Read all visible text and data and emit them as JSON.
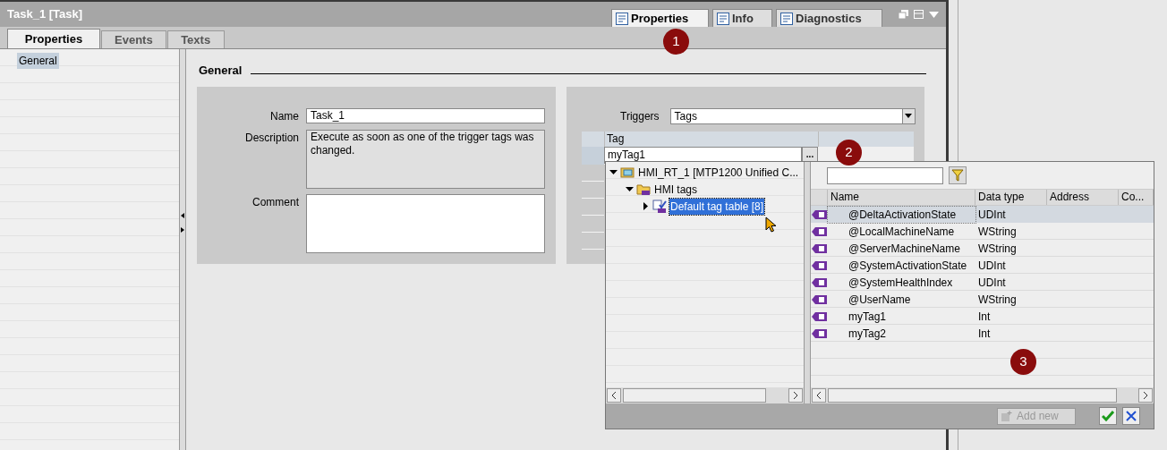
{
  "window": {
    "title": "Task_1 [Task]"
  },
  "inspector_tabs": [
    {
      "label": "Properties",
      "selected": true
    },
    {
      "label": "Info",
      "selected": false
    },
    {
      "label": "Diagnostics",
      "selected": false
    }
  ],
  "tabs": [
    {
      "label": "Properties",
      "selected": true
    },
    {
      "label": "Events",
      "selected": false
    },
    {
      "label": "Texts",
      "selected": false
    }
  ],
  "nav": {
    "items": [
      {
        "label": "General",
        "selected": true
      }
    ]
  },
  "section_title": "General",
  "form": {
    "name": {
      "label": "Name",
      "value": "Task_1"
    },
    "description": {
      "label": "Description",
      "value": "Execute as soon as one of the trigger tags was changed."
    },
    "comment": {
      "label": "Comment"
    }
  },
  "triggers": {
    "label": "Triggers",
    "value": "Tags"
  },
  "tag_table": {
    "column": "Tag",
    "value": "myTag1",
    "browse": "..."
  },
  "tree": [
    {
      "label": "HMI_RT_1 [MTP1200 Unified C...",
      "expanded": true,
      "selected": false,
      "children": [
        {
          "label": "HMI tags",
          "expanded": true,
          "selected": false,
          "children": [
            {
              "label": "Default tag table [8]",
              "expanded": false,
              "selected": true
            }
          ]
        }
      ]
    }
  ],
  "tag_list": {
    "columns": [
      "Name",
      "Data type",
      "Address",
      "Co..."
    ],
    "rows": [
      {
        "name": "@DeltaActivationState",
        "data_type": "UDInt",
        "selected": true
      },
      {
        "name": "@LocalMachineName",
        "data_type": "WString",
        "selected": false
      },
      {
        "name": "@ServerMachineName",
        "data_type": "WString",
        "selected": false
      },
      {
        "name": "@SystemActivationState",
        "data_type": "UDInt",
        "selected": false
      },
      {
        "name": "@SystemHealthIndex",
        "data_type": "UDInt",
        "selected": false
      },
      {
        "name": "@UserName",
        "data_type": "WString",
        "selected": false
      },
      {
        "name": "myTag1",
        "data_type": "Int",
        "selected": false
      },
      {
        "name": "myTag2",
        "data_type": "Int",
        "selected": false
      }
    ]
  },
  "add_new": {
    "label": "Add new",
    "disabled": true
  },
  "callouts": [
    "1",
    "2",
    "3"
  ]
}
